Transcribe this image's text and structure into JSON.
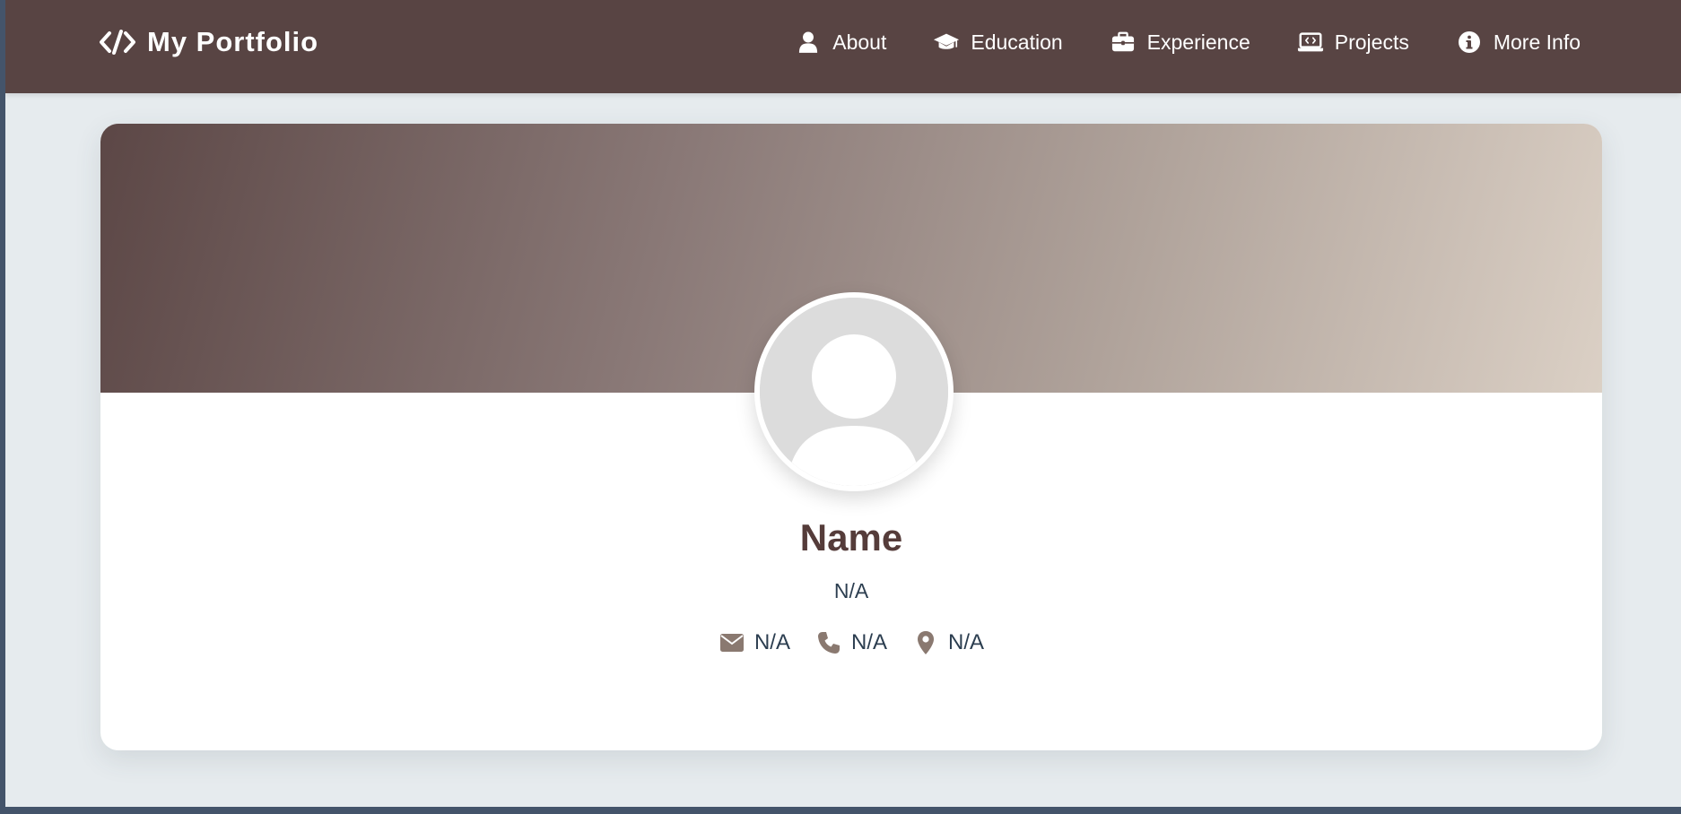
{
  "navbar": {
    "brand": {
      "icon": "code-icon",
      "title": "My Portfolio"
    },
    "items": [
      {
        "label": "About",
        "icon": "user-icon"
      },
      {
        "label": "Education",
        "icon": "graduation-cap-icon"
      },
      {
        "label": "Experience",
        "icon": "briefcase-icon"
      },
      {
        "label": "Projects",
        "icon": "laptop-code-icon"
      },
      {
        "label": "More Info",
        "icon": "info-circle-icon"
      }
    ]
  },
  "profile": {
    "avatar_icon": "default-avatar-icon",
    "name": "Name",
    "subtitle": "N/A",
    "contacts": [
      {
        "icon": "envelope-icon",
        "value": "N/A"
      },
      {
        "icon": "phone-icon",
        "value": "N/A"
      },
      {
        "icon": "location-pin-icon",
        "value": "N/A"
      }
    ]
  },
  "colors": {
    "navbar_bg": "#584443",
    "page_bg": "#e6ebee",
    "name_text": "#553c3a",
    "body_text": "#2c3e50",
    "contact_icon": "#8a7970",
    "cover_gradient_start": "#5c4746",
    "cover_gradient_end": "#dbd0c5"
  }
}
